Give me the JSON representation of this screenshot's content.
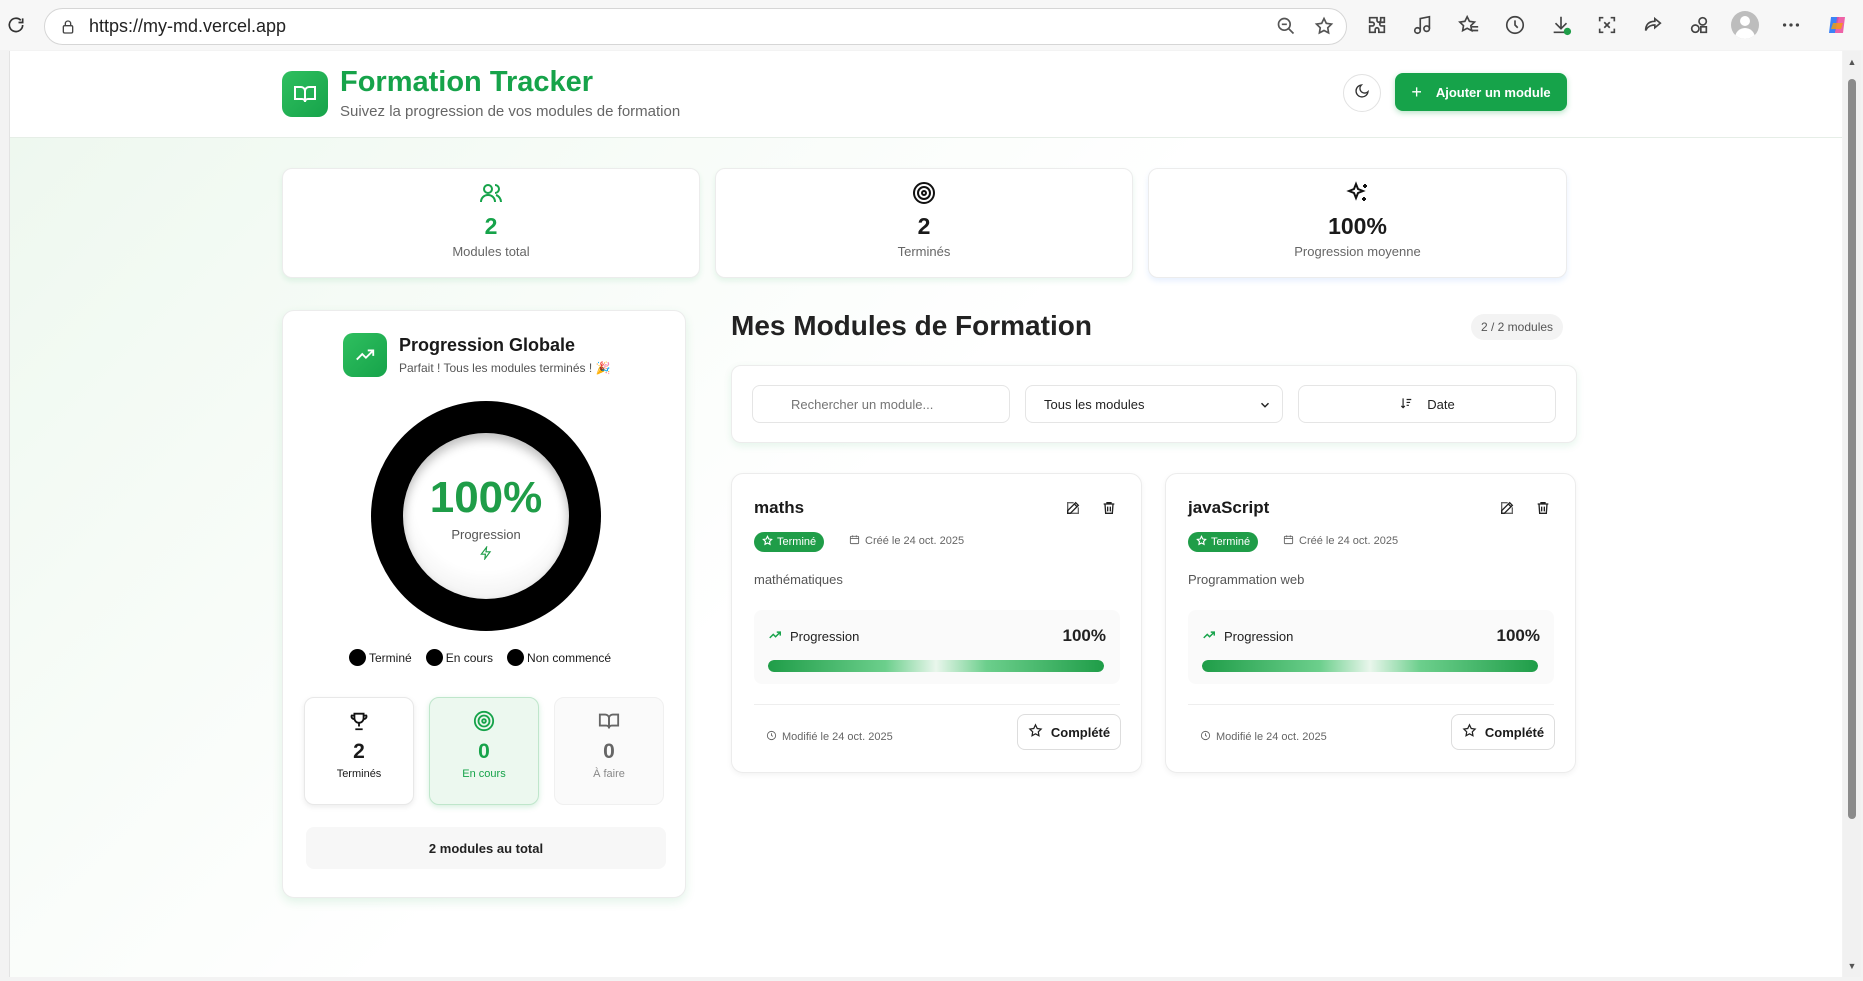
{
  "browser": {
    "url": "https://my-md.vercel.app",
    "toolbar_icons": [
      "extensions-icon",
      "media-icon",
      "favorites-icon",
      "history-icon",
      "downloads-icon",
      "screenshot-icon",
      "share-icon",
      "collections-icon",
      "profile-icon",
      "more-icon",
      "copilot-icon"
    ]
  },
  "header": {
    "title": "Formation Tracker",
    "subtitle": "Suivez la progression de vos modules de formation",
    "add_button": "Ajouter un module"
  },
  "stats": [
    {
      "value": "2",
      "label": "Modules total",
      "icon": "users-icon",
      "color": "#16a34a"
    },
    {
      "value": "2",
      "label": "Terminés",
      "icon": "target-icon",
      "color": "#111111"
    },
    {
      "value": "100%",
      "label": "Progression moyenne",
      "icon": "sparkles-icon",
      "color": "#111111"
    }
  ],
  "progress": {
    "title": "Progression Globale",
    "subtitle": "Parfait ! Tous les modules terminés ! 🎉",
    "percent": "100%",
    "percent_label": "Progression",
    "legend": [
      "Terminé",
      "En cours",
      "Non commencé"
    ],
    "mini": [
      {
        "value": "2",
        "label": "Terminés"
      },
      {
        "value": "0",
        "label": "En cours"
      },
      {
        "value": "0",
        "label": "À faire"
      }
    ],
    "total_bold": "2",
    "total_rest": " modules au total"
  },
  "modules_section": {
    "title": "Mes Modules de Formation",
    "count": "2 / 2 modules",
    "search_placeholder": "Rechercher un module...",
    "filter_selected": "Tous les modules",
    "sort_label": "Date"
  },
  "modules": [
    {
      "name": "maths",
      "status": "Terminé",
      "created": "Créé le 24 oct. 2025",
      "description": "mathématiques",
      "progress_label": "Progression",
      "progress_value": "100%",
      "progress_fraction": 1.0,
      "modified": "Modifié le 24 oct. 2025",
      "button": "Complété"
    },
    {
      "name": "javaScript",
      "status": "Terminé",
      "created": "Créé le 24 oct. 2025",
      "description": "Programmation web",
      "progress_label": "Progression",
      "progress_value": "100%",
      "progress_fraction": 1.0,
      "modified": "Modifié le 24 oct. 2025",
      "button": "Complété"
    }
  ],
  "colors": {
    "accent": "#16a34a",
    "accent_text": "#1f9d48"
  }
}
